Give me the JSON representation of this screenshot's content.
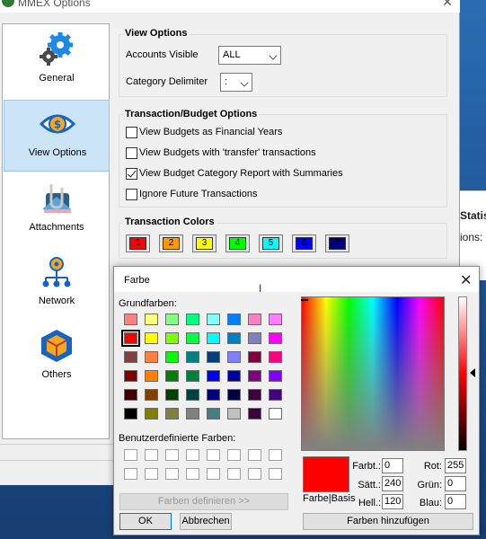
{
  "window": {
    "title": "MMEX Options",
    "close_symbol": "✕"
  },
  "background_window": {
    "text1": "Statis",
    "text2": "ions:"
  },
  "sidebar": {
    "items": [
      {
        "label": "General",
        "icon": "gear-icon"
      },
      {
        "label": "View Options",
        "icon": "eye-icon"
      },
      {
        "label": "Attachments",
        "icon": "paperclip-icon"
      },
      {
        "label": "Network",
        "icon": "network-icon"
      },
      {
        "label": "Others",
        "icon": "cube-icon"
      }
    ],
    "selected": "View Options"
  },
  "view_options": {
    "title": "View Options",
    "accounts_visible_label": "Accounts Visible",
    "accounts_visible_value": "ALL",
    "category_delimiter_label": "Category Delimiter",
    "category_delimiter_value": ":"
  },
  "transaction_budget": {
    "title": "Transaction/Budget Options",
    "options": [
      {
        "label": "View Budgets as Financial Years",
        "checked": false
      },
      {
        "label": "View Budgets with 'transfer' transactions",
        "checked": false
      },
      {
        "label": "View Budget Category Report with Summaries",
        "checked": true
      },
      {
        "label": "Ignore Future Transactions",
        "checked": false
      }
    ]
  },
  "transaction_colors": {
    "title": "Transaction Colors",
    "buttons": [
      {
        "label": "1",
        "color": "#ff0000"
      },
      {
        "label": "2",
        "color": "#ff9900"
      },
      {
        "label": "3",
        "color": "#ffff00"
      },
      {
        "label": "4",
        "color": "#00ff00"
      },
      {
        "label": "5",
        "color": "#00ffff"
      },
      {
        "label": "6",
        "color": "#0000ff"
      },
      {
        "label": "7",
        "color": "#000080"
      }
    ]
  },
  "color_dialog": {
    "title": "Farbe",
    "close_symbol": "✕",
    "cursor_symbol": "I",
    "basic_label": "Grundfarben:",
    "custom_label": "Benutzerdefinierte Farben:",
    "define_button": "Farben definieren >>",
    "ok_button": "OK",
    "cancel_button": "Abbrechen",
    "add_button": "Farben hinzufügen",
    "preview_label": "Farbe|Basis",
    "fields": {
      "hue_label": "Farbt.:",
      "hue": "0",
      "sat_label": "Sätt.:",
      "sat": "240",
      "lum_label": "Hell.:",
      "lum": "120",
      "red_label": "Rot:",
      "red": "255",
      "green_label": "Grün:",
      "green": "0",
      "blue_label": "Blau:",
      "blue": "0"
    },
    "basic_colors": [
      [
        "#ff8080",
        "#ffff80",
        "#80ff80",
        "#00ff80",
        "#80ffff",
        "#0080ff",
        "#ff80c0",
        "#ff80ff"
      ],
      [
        "#ff0000",
        "#ffff00",
        "#80ff00",
        "#00ff40",
        "#00ffff",
        "#0080c0",
        "#8080c0",
        "#ff00ff"
      ],
      [
        "#804040",
        "#ff8040",
        "#00ff00",
        "#008080",
        "#004080",
        "#8080ff",
        "#800040",
        "#ff0080"
      ],
      [
        "#800000",
        "#ff8000",
        "#008000",
        "#008040",
        "#0000ff",
        "#0000a0",
        "#800080",
        "#8000ff"
      ],
      [
        "#400000",
        "#804000",
        "#004000",
        "#004040",
        "#000080",
        "#000040",
        "#400040",
        "#400080"
      ],
      [
        "#000000",
        "#808000",
        "#808040",
        "#808080",
        "#408080",
        "#c0c0c0",
        "#400040",
        "#ffffff"
      ]
    ],
    "selected_basic": "#ff0000"
  }
}
